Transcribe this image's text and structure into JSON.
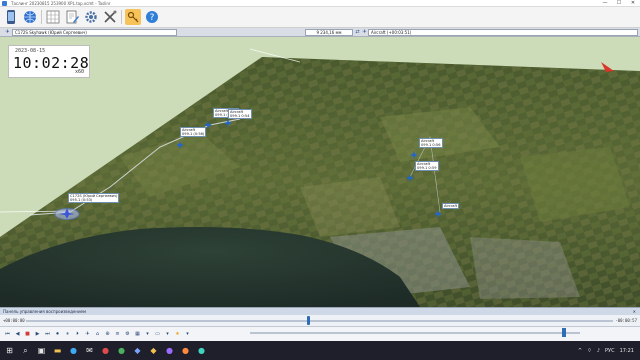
{
  "window": {
    "title": "Таслинг 20230815 253900 XPL.tap.xcmt - Taslinr",
    "minimize": "—",
    "maximize": "☐",
    "close": "✕"
  },
  "toolbar": {
    "icons": [
      "mobile-icon",
      "globe-icon",
      "grid-icon",
      "document-edit-icon",
      "settings-gear-icon",
      "tools-icon",
      "key-icon",
      "help-icon"
    ]
  },
  "selectbar": {
    "aircraft_left": "С172S Skyhawk (Юрий Сергеевич)",
    "value_center": "9 234,16 мм",
    "aircraft_right": "Aircraft (+00:03:51)"
  },
  "clock": {
    "date": "2023-08-15",
    "time": "10:02:28",
    "speed": "x60"
  },
  "aircraft": [
    {
      "name": "Aircraft",
      "info": "099.1 (0:59)"
    },
    {
      "name": "Aircraft",
      "info": "099.1 0:54"
    },
    {
      "name": "Aircraft",
      "info": "099.1 (0:56)"
    },
    {
      "name": "Aircraft",
      "info": "099.1 0:56"
    },
    {
      "name": "Aircraft",
      "info": "099.1 0:59"
    },
    {
      "name": "Aircraft",
      "info": ""
    },
    {
      "name": "C172S (Юрий Сергеевич)",
      "info": "095.1 (0:53)"
    }
  ],
  "panel": {
    "title": "Панель управления воспроизведением"
  },
  "timeline": {
    "elapsed": "+00:00:00",
    "remaining": "-00:00:57",
    "progress": 0.48
  },
  "controls": {
    "buttons": [
      "⏮",
      "◀",
      "■",
      "▶",
      "⏭",
      "⏺",
      "⏸",
      "⏵"
    ],
    "speed_level": 0.95
  },
  "taskbar": {
    "lang": "РУС",
    "time": "17:21"
  },
  "colors": {
    "accent": "#2d6db5",
    "aircraft_marker": "#1e66d6",
    "selected_marker": "#5b7cf0"
  }
}
